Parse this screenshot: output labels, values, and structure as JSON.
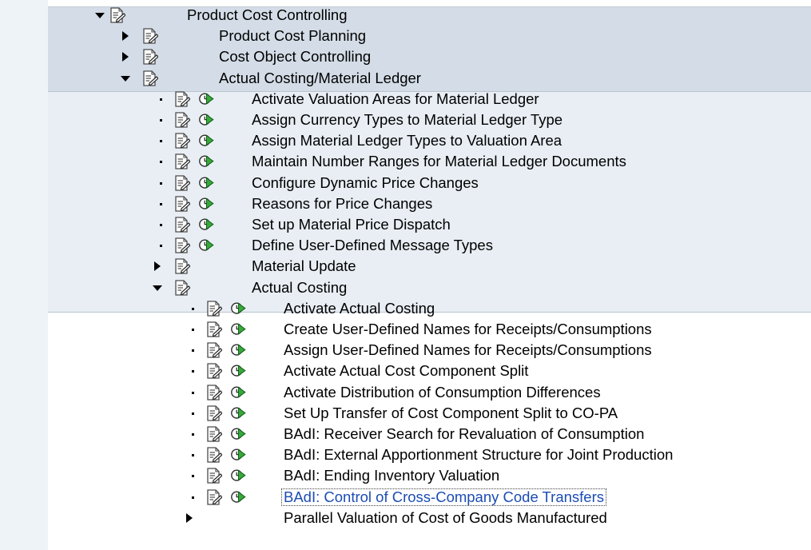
{
  "tree": [
    {
      "id": "r0",
      "level": 0,
      "type": "folder",
      "expanded": true,
      "label": "Product Cost Controlling"
    },
    {
      "id": "r1",
      "level": 1,
      "type": "folder",
      "expanded": false,
      "label": "Product Cost Planning"
    },
    {
      "id": "r2",
      "level": 1,
      "type": "folder",
      "expanded": false,
      "label": "Cost Object Controlling"
    },
    {
      "id": "r3",
      "level": 1,
      "type": "folder",
      "expanded": true,
      "label": "Actual Costing/Material Ledger"
    },
    {
      "id": "r4",
      "level": 2,
      "type": "activity",
      "label": "Activate Valuation Areas for Material Ledger"
    },
    {
      "id": "r5",
      "level": 2,
      "type": "activity",
      "label": "Assign Currency Types to Material Ledger Type"
    },
    {
      "id": "r6",
      "level": 2,
      "type": "activity",
      "label": "Assign Material Ledger Types to Valuation Area"
    },
    {
      "id": "r7",
      "level": 2,
      "type": "activity",
      "label": "Maintain Number Ranges for Material Ledger Documents"
    },
    {
      "id": "r8",
      "level": 2,
      "type": "activity",
      "label": "Configure Dynamic Price Changes"
    },
    {
      "id": "r9",
      "level": 2,
      "type": "activity",
      "label": "Reasons for Price Changes"
    },
    {
      "id": "r10",
      "level": 2,
      "type": "activity",
      "label": "Set up Material Price Dispatch"
    },
    {
      "id": "r11",
      "level": 2,
      "type": "activity",
      "label": "Define User-Defined Message Types"
    },
    {
      "id": "r12",
      "level": 2,
      "type": "folder",
      "expanded": false,
      "label": "Material Update"
    },
    {
      "id": "r13",
      "level": 2,
      "type": "folder",
      "expanded": true,
      "label": "Actual Costing"
    },
    {
      "id": "r14",
      "level": 3,
      "type": "activity",
      "label": "Activate Actual Costing"
    },
    {
      "id": "r15",
      "level": 3,
      "type": "activity",
      "label": "Create User-Defined Names for Receipts/Consumptions"
    },
    {
      "id": "r16",
      "level": 3,
      "type": "activity",
      "label": "Assign User-Defined Names for Receipts/Consumptions"
    },
    {
      "id": "r17",
      "level": 3,
      "type": "activity",
      "label": "Activate Actual Cost Component Split"
    },
    {
      "id": "r18",
      "level": 3,
      "type": "activity",
      "label": "Activate Distribution of Consumption Differences"
    },
    {
      "id": "r19",
      "level": 3,
      "type": "activity",
      "label": "Set Up Transfer of Cost Component Split to CO-PA"
    },
    {
      "id": "r20",
      "level": 3,
      "type": "activity",
      "label": "BAdI: Receiver Search for Revaluation of Consumption"
    },
    {
      "id": "r21",
      "level": 3,
      "type": "activity",
      "label": "BAdI: External Apportionment Structure for Joint Production"
    },
    {
      "id": "r22",
      "level": 3,
      "type": "activity",
      "label": "BAdI: Ending Inventory Valuation"
    },
    {
      "id": "r23",
      "level": 3,
      "type": "activity",
      "selected": true,
      "label": "BAdI: Control of Cross-Company Code Transfers"
    },
    {
      "id": "r24",
      "level": 3,
      "type": "folder",
      "expanded": false,
      "noicon": true,
      "label": "Parallel Valuation of Cost of Goods Manufactured"
    }
  ],
  "icons": {
    "document": "documentation-icon",
    "execute": "execute-activity-icon",
    "expanded": "triangle-down-icon",
    "collapsed": "triangle-right-icon"
  },
  "colors": {
    "band_level0": "#d4dde7",
    "band_level1": "#e8eef4",
    "band_level2": "#ffffff",
    "selected_text": "#1c4cb4"
  }
}
